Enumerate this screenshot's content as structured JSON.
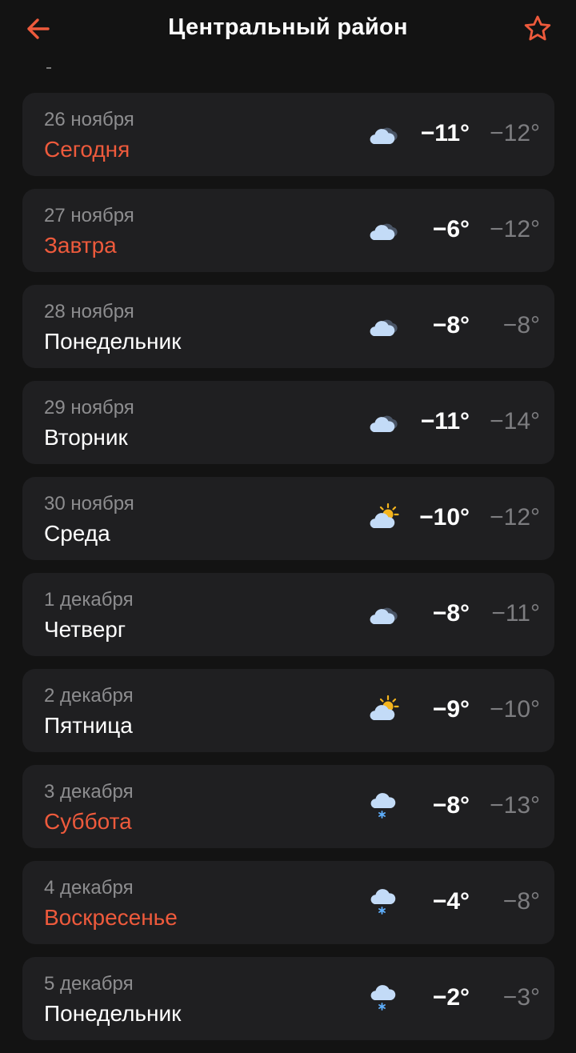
{
  "header": {
    "title": "Центральный район"
  },
  "days": [
    {
      "date": "26 ноября",
      "day": "Сегодня",
      "weekend": true,
      "icon": "cloudy-icon",
      "max": "−11°",
      "min": "−12°"
    },
    {
      "date": "27 ноября",
      "day": "Завтра",
      "weekend": true,
      "icon": "cloudy-icon",
      "max": "−6°",
      "min": "−12°"
    },
    {
      "date": "28 ноября",
      "day": "Понедельник",
      "weekend": false,
      "icon": "cloudy-icon",
      "max": "−8°",
      "min": "−8°"
    },
    {
      "date": "29 ноября",
      "day": "Вторник",
      "weekend": false,
      "icon": "cloudy-icon",
      "max": "−11°",
      "min": "−14°"
    },
    {
      "date": "30 ноября",
      "day": "Среда",
      "weekend": false,
      "icon": "partly-cloudy-icon",
      "max": "−10°",
      "min": "−12°"
    },
    {
      "date": "1 декабря",
      "day": "Четверг",
      "weekend": false,
      "icon": "cloudy-icon",
      "max": "−8°",
      "min": "−11°"
    },
    {
      "date": "2 декабря",
      "day": "Пятница",
      "weekend": false,
      "icon": "partly-cloudy-icon",
      "max": "−9°",
      "min": "−10°"
    },
    {
      "date": "3 декабря",
      "day": "Суббота",
      "weekend": true,
      "icon": "snow-icon",
      "max": "−8°",
      "min": "−13°"
    },
    {
      "date": "4 декабря",
      "day": "Воскресенье",
      "weekend": true,
      "icon": "snow-icon",
      "max": "−4°",
      "min": "−8°"
    },
    {
      "date": "5 декабря",
      "day": "Понедельник",
      "weekend": false,
      "icon": "snow-icon",
      "max": "−2°",
      "min": "−3°"
    }
  ],
  "colors": {
    "accent": "#ee5a3c",
    "card": "#1f1f21",
    "background": "#131313"
  }
}
